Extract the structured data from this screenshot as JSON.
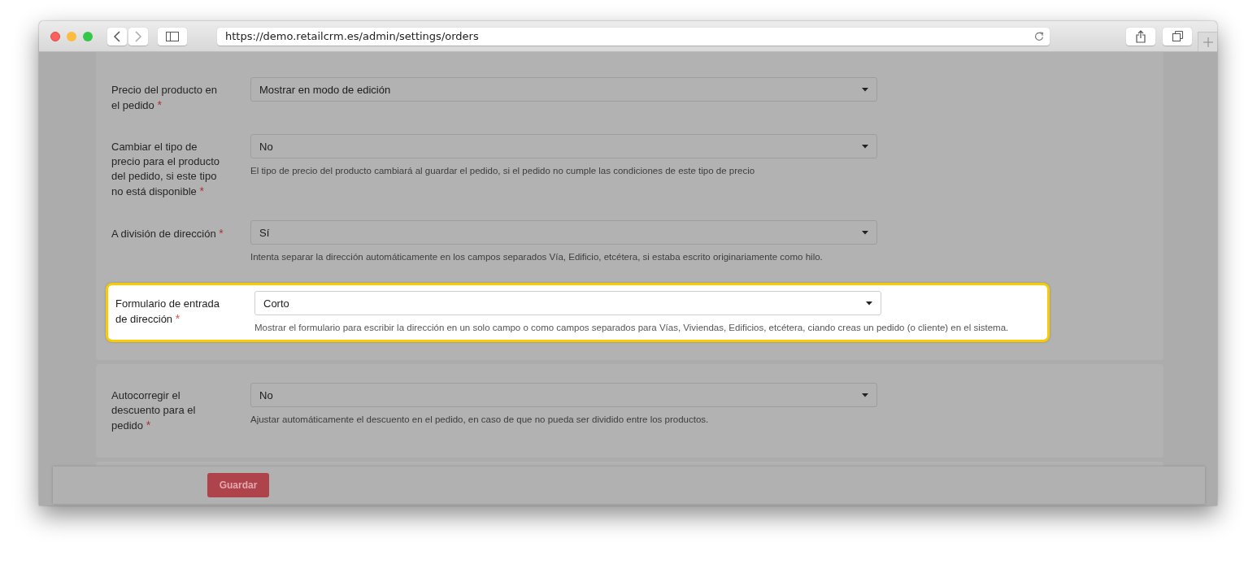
{
  "browser": {
    "url": "https://demo.retailcrm.es/admin/settings/orders"
  },
  "sections": [
    {
      "rows": [
        {
          "label": "Precio del producto en el pedido",
          "required_mark": "*",
          "value": "Mostrar en modo de edición",
          "highlighted": false
        },
        {
          "label": "Cambiar el tipo de precio para el producto del pedido, si este tipo no está disponible",
          "required_mark": "*",
          "value": "No",
          "help": "El tipo de precio del producto cambiará al guardar el pedido, si el pedido no cumple las condiciones de este tipo de precio",
          "highlighted": false
        },
        {
          "label": "A división de dirección",
          "required_mark": "*",
          "value": "Sí",
          "help": "Intenta separar la dirección automáticamente en los campos separados Vía, Edificio, etcétera, si estaba escrito originariamente como hilo.",
          "highlighted": false
        },
        {
          "label": "Formulario de entrada de dirección",
          "required_mark": "*",
          "value": "Corto",
          "help": "Mostrar el formulario para escribir la dirección en un solo campo o como campos separados para Vías, Viviendas, Edificios, etcétera, ciando creas un pedido (o cliente) en el sistema.",
          "highlighted": true
        }
      ]
    },
    {
      "rows": [
        {
          "label": "Autocorregir el descuento para el pedido",
          "required_mark": "*",
          "value": "No",
          "help": "Ajustar automáticamente el descuento en el pedido, en caso de que no pueda ser dividido entre los productos.",
          "highlighted": false
        }
      ]
    }
  ],
  "footer": {
    "save_button": "Guardar"
  }
}
